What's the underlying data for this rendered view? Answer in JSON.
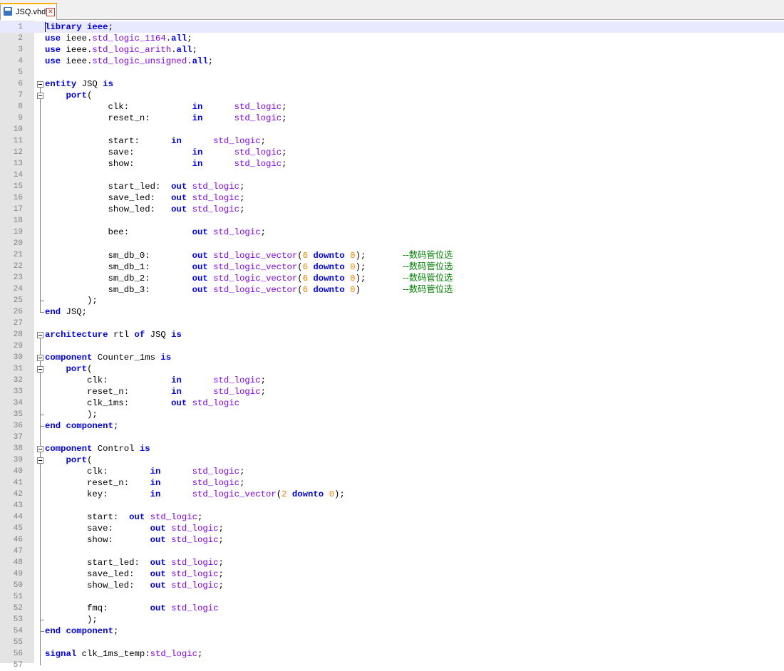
{
  "tab": {
    "filename": "JSQ.vhd",
    "close_glyph": "✕"
  },
  "colors": {
    "keyword": "#0000ff",
    "type": "#8000ff",
    "number": "#ff8000",
    "comment": "#008000"
  },
  "code_lines": [
    {
      "n": 1,
      "t": [
        [
          "k",
          "library"
        ],
        [
          "i",
          " "
        ],
        [
          "k",
          "ieee"
        ],
        [
          "i",
          ";"
        ]
      ]
    },
    {
      "n": 2,
      "t": [
        [
          "k",
          "use"
        ],
        [
          "i",
          " ieee."
        ],
        [
          "ty",
          "std_logic_1164"
        ],
        [
          "i",
          "."
        ],
        [
          "k",
          "all"
        ],
        [
          "i",
          ";"
        ]
      ]
    },
    {
      "n": 3,
      "t": [
        [
          "k",
          "use"
        ],
        [
          "i",
          " ieee."
        ],
        [
          "ty",
          "std_logic_arith"
        ],
        [
          "i",
          "."
        ],
        [
          "k",
          "all"
        ],
        [
          "i",
          ";"
        ]
      ]
    },
    {
      "n": 4,
      "t": [
        [
          "k",
          "use"
        ],
        [
          "i",
          " ieee."
        ],
        [
          "ty",
          "std_logic_unsigned"
        ],
        [
          "i",
          "."
        ],
        [
          "k",
          "all"
        ],
        [
          "i",
          ";"
        ]
      ]
    },
    {
      "n": 5,
      "t": []
    },
    {
      "n": 6,
      "t": [
        [
          "k",
          "entity"
        ],
        [
          "i",
          " JSQ "
        ],
        [
          "k",
          "is"
        ]
      ]
    },
    {
      "n": 7,
      "t": [
        [
          "i",
          "    "
        ],
        [
          "k",
          "port"
        ],
        [
          "i",
          "("
        ]
      ]
    },
    {
      "n": 8,
      "t": [
        [
          "i",
          "            clk:            "
        ],
        [
          "k",
          "in"
        ],
        [
          "i",
          "      "
        ],
        [
          "ty",
          "std_logic"
        ],
        [
          "i",
          ";"
        ]
      ]
    },
    {
      "n": 9,
      "t": [
        [
          "i",
          "            reset_n:        "
        ],
        [
          "k",
          "in"
        ],
        [
          "i",
          "      "
        ],
        [
          "ty",
          "std_logic"
        ],
        [
          "i",
          ";"
        ]
      ]
    },
    {
      "n": 10,
      "t": []
    },
    {
      "n": 11,
      "t": [
        [
          "i",
          "            start:      "
        ],
        [
          "k",
          "in"
        ],
        [
          "i",
          "      "
        ],
        [
          "ty",
          "std_logic"
        ],
        [
          "i",
          ";"
        ]
      ]
    },
    {
      "n": 12,
      "t": [
        [
          "i",
          "            save:           "
        ],
        [
          "k",
          "in"
        ],
        [
          "i",
          "      "
        ],
        [
          "ty",
          "std_logic"
        ],
        [
          "i",
          ";"
        ]
      ]
    },
    {
      "n": 13,
      "t": [
        [
          "i",
          "            show:           "
        ],
        [
          "k",
          "in"
        ],
        [
          "i",
          "      "
        ],
        [
          "ty",
          "std_logic"
        ],
        [
          "i",
          ";"
        ]
      ]
    },
    {
      "n": 14,
      "t": []
    },
    {
      "n": 15,
      "t": [
        [
          "i",
          "            start_led:  "
        ],
        [
          "k",
          "out"
        ],
        [
          "i",
          " "
        ],
        [
          "ty",
          "std_logic"
        ],
        [
          "i",
          ";"
        ]
      ]
    },
    {
      "n": 16,
      "t": [
        [
          "i",
          "            save_led:   "
        ],
        [
          "k",
          "out"
        ],
        [
          "i",
          " "
        ],
        [
          "ty",
          "std_logic"
        ],
        [
          "i",
          ";"
        ]
      ]
    },
    {
      "n": 17,
      "t": [
        [
          "i",
          "            show_led:   "
        ],
        [
          "k",
          "out"
        ],
        [
          "i",
          " "
        ],
        [
          "ty",
          "std_logic"
        ],
        [
          "i",
          ";"
        ]
      ]
    },
    {
      "n": 18,
      "t": []
    },
    {
      "n": 19,
      "t": [
        [
          "i",
          "            bee:            "
        ],
        [
          "k",
          "out"
        ],
        [
          "i",
          " "
        ],
        [
          "ty",
          "std_logic"
        ],
        [
          "i",
          ";"
        ]
      ]
    },
    {
      "n": 20,
      "t": []
    },
    {
      "n": 21,
      "t": [
        [
          "i",
          "            sm_db_0:        "
        ],
        [
          "k",
          "out"
        ],
        [
          "i",
          " "
        ],
        [
          "ty",
          "std_logic_vector"
        ],
        [
          "i",
          "("
        ],
        [
          "n",
          "6"
        ],
        [
          "i",
          " "
        ],
        [
          "k",
          "downto"
        ],
        [
          "i",
          " "
        ],
        [
          "n",
          "0"
        ],
        [
          "i",
          ");       "
        ],
        [
          "c",
          "--数码管位选"
        ]
      ]
    },
    {
      "n": 22,
      "t": [
        [
          "i",
          "            sm_db_1:        "
        ],
        [
          "k",
          "out"
        ],
        [
          "i",
          " "
        ],
        [
          "ty",
          "std_logic_vector"
        ],
        [
          "i",
          "("
        ],
        [
          "n",
          "6"
        ],
        [
          "i",
          " "
        ],
        [
          "k",
          "downto"
        ],
        [
          "i",
          " "
        ],
        [
          "n",
          "0"
        ],
        [
          "i",
          ");       "
        ],
        [
          "c",
          "--数码管位选"
        ]
      ]
    },
    {
      "n": 23,
      "t": [
        [
          "i",
          "            sm_db_2:        "
        ],
        [
          "k",
          "out"
        ],
        [
          "i",
          " "
        ],
        [
          "ty",
          "std_logic_vector"
        ],
        [
          "i",
          "("
        ],
        [
          "n",
          "6"
        ],
        [
          "i",
          " "
        ],
        [
          "k",
          "downto"
        ],
        [
          "i",
          " "
        ],
        [
          "n",
          "0"
        ],
        [
          "i",
          ");       "
        ],
        [
          "c",
          "--数码管位选"
        ]
      ]
    },
    {
      "n": 24,
      "t": [
        [
          "i",
          "            sm_db_3:        "
        ],
        [
          "k",
          "out"
        ],
        [
          "i",
          " "
        ],
        [
          "ty",
          "std_logic_vector"
        ],
        [
          "i",
          "("
        ],
        [
          "n",
          "6"
        ],
        [
          "i",
          " "
        ],
        [
          "k",
          "downto"
        ],
        [
          "i",
          " "
        ],
        [
          "n",
          "0"
        ],
        [
          "i",
          ")        "
        ],
        [
          "c",
          "--数码管位选"
        ]
      ]
    },
    {
      "n": 25,
      "t": [
        [
          "i",
          "        );"
        ]
      ]
    },
    {
      "n": 26,
      "t": [
        [
          "k",
          "end"
        ],
        [
          "i",
          " JSQ;"
        ]
      ]
    },
    {
      "n": 27,
      "t": []
    },
    {
      "n": 28,
      "t": [
        [
          "k",
          "architecture"
        ],
        [
          "i",
          " rtl "
        ],
        [
          "k",
          "of"
        ],
        [
          "i",
          " JSQ "
        ],
        [
          "k",
          "is"
        ]
      ]
    },
    {
      "n": 29,
      "t": []
    },
    {
      "n": 30,
      "t": [
        [
          "k",
          "component"
        ],
        [
          "i",
          " Counter_1ms "
        ],
        [
          "k",
          "is"
        ]
      ]
    },
    {
      "n": 31,
      "t": [
        [
          "i",
          "    "
        ],
        [
          "k",
          "port"
        ],
        [
          "i",
          "("
        ]
      ]
    },
    {
      "n": 32,
      "t": [
        [
          "i",
          "        clk:            "
        ],
        [
          "k",
          "in"
        ],
        [
          "i",
          "      "
        ],
        [
          "ty",
          "std_logic"
        ],
        [
          "i",
          ";"
        ]
      ]
    },
    {
      "n": 33,
      "t": [
        [
          "i",
          "        reset_n:        "
        ],
        [
          "k",
          "in"
        ],
        [
          "i",
          "      "
        ],
        [
          "ty",
          "std_logic"
        ],
        [
          "i",
          ";"
        ]
      ]
    },
    {
      "n": 34,
      "t": [
        [
          "i",
          "        clk_1ms:        "
        ],
        [
          "k",
          "out"
        ],
        [
          "i",
          " "
        ],
        [
          "ty",
          "std_logic"
        ]
      ]
    },
    {
      "n": 35,
      "t": [
        [
          "i",
          "        );"
        ]
      ]
    },
    {
      "n": 36,
      "t": [
        [
          "k",
          "end"
        ],
        [
          "i",
          " "
        ],
        [
          "k",
          "component"
        ],
        [
          "i",
          ";"
        ]
      ]
    },
    {
      "n": 37,
      "t": []
    },
    {
      "n": 38,
      "t": [
        [
          "k",
          "component"
        ],
        [
          "i",
          " Control "
        ],
        [
          "k",
          "is"
        ]
      ]
    },
    {
      "n": 39,
      "t": [
        [
          "i",
          "    "
        ],
        [
          "k",
          "port"
        ],
        [
          "i",
          "("
        ]
      ]
    },
    {
      "n": 40,
      "t": [
        [
          "i",
          "        clk:        "
        ],
        [
          "k",
          "in"
        ],
        [
          "i",
          "      "
        ],
        [
          "ty",
          "std_logic"
        ],
        [
          "i",
          ";"
        ]
      ]
    },
    {
      "n": 41,
      "t": [
        [
          "i",
          "        reset_n:    "
        ],
        [
          "k",
          "in"
        ],
        [
          "i",
          "      "
        ],
        [
          "ty",
          "std_logic"
        ],
        [
          "i",
          ";"
        ]
      ]
    },
    {
      "n": 42,
      "t": [
        [
          "i",
          "        key:        "
        ],
        [
          "k",
          "in"
        ],
        [
          "i",
          "      "
        ],
        [
          "ty",
          "std_logic_vector"
        ],
        [
          "i",
          "("
        ],
        [
          "n",
          "2"
        ],
        [
          "i",
          " "
        ],
        [
          "k",
          "downto"
        ],
        [
          "i",
          " "
        ],
        [
          "n",
          "0"
        ],
        [
          "i",
          ");"
        ]
      ]
    },
    {
      "n": 43,
      "t": []
    },
    {
      "n": 44,
      "t": [
        [
          "i",
          "        start:  "
        ],
        [
          "k",
          "out"
        ],
        [
          "i",
          " "
        ],
        [
          "ty",
          "std_logic"
        ],
        [
          "i",
          ";"
        ]
      ]
    },
    {
      "n": 45,
      "t": [
        [
          "i",
          "        save:       "
        ],
        [
          "k",
          "out"
        ],
        [
          "i",
          " "
        ],
        [
          "ty",
          "std_logic"
        ],
        [
          "i",
          ";"
        ]
      ]
    },
    {
      "n": 46,
      "t": [
        [
          "i",
          "        show:       "
        ],
        [
          "k",
          "out"
        ],
        [
          "i",
          " "
        ],
        [
          "ty",
          "std_logic"
        ],
        [
          "i",
          ";"
        ]
      ]
    },
    {
      "n": 47,
      "t": []
    },
    {
      "n": 48,
      "t": [
        [
          "i",
          "        start_led:  "
        ],
        [
          "k",
          "out"
        ],
        [
          "i",
          " "
        ],
        [
          "ty",
          "std_logic"
        ],
        [
          "i",
          ";"
        ]
      ]
    },
    {
      "n": 49,
      "t": [
        [
          "i",
          "        save_led:   "
        ],
        [
          "k",
          "out"
        ],
        [
          "i",
          " "
        ],
        [
          "ty",
          "std_logic"
        ],
        [
          "i",
          ";"
        ]
      ]
    },
    {
      "n": 50,
      "t": [
        [
          "i",
          "        show_led:   "
        ],
        [
          "k",
          "out"
        ],
        [
          "i",
          " "
        ],
        [
          "ty",
          "std_logic"
        ],
        [
          "i",
          ";"
        ]
      ]
    },
    {
      "n": 51,
      "t": []
    },
    {
      "n": 52,
      "t": [
        [
          "i",
          "        fmq:        "
        ],
        [
          "k",
          "out"
        ],
        [
          "i",
          " "
        ],
        [
          "ty",
          "std_logic"
        ]
      ]
    },
    {
      "n": 53,
      "t": [
        [
          "i",
          "        );"
        ]
      ]
    },
    {
      "n": 54,
      "t": [
        [
          "k",
          "end"
        ],
        [
          "i",
          " "
        ],
        [
          "k",
          "component"
        ],
        [
          "i",
          ";"
        ]
      ]
    },
    {
      "n": 55,
      "t": []
    },
    {
      "n": 56,
      "t": [
        [
          "k",
          "signal"
        ],
        [
          "i",
          " clk_1ms_temp:"
        ],
        [
          "ty",
          "std_logic"
        ],
        [
          "i",
          ";"
        ]
      ]
    },
    {
      "n": 57,
      "t": []
    }
  ]
}
